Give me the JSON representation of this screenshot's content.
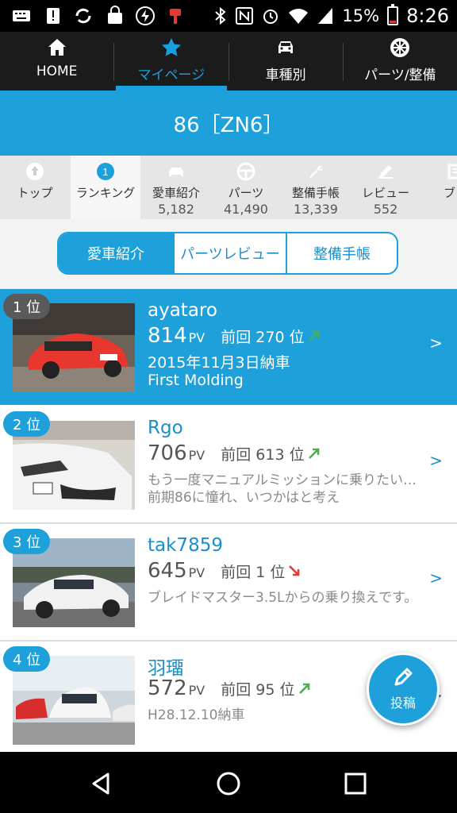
{
  "status_bar": {
    "battery": "15%",
    "time": "8:26",
    "battery_level": 0.15,
    "icons": [
      "keyboard-icon",
      "alert-icon",
      "sync-icon",
      "shopping-bag-icon",
      "charging-icon",
      "brush-icon",
      "bluetooth-icon",
      "nfc-icon",
      "alarm-icon",
      "wifi-icon",
      "signal-icon",
      "battery-icon"
    ]
  },
  "top_nav": {
    "items": [
      {
        "label": "HOME",
        "icon": "home-icon"
      },
      {
        "label": "マイページ",
        "icon": "star-icon"
      },
      {
        "label": "車種別",
        "icon": "car-icon"
      },
      {
        "label": "パーツ/整備",
        "icon": "wheel-icon"
      }
    ],
    "active_index": 1
  },
  "model": {
    "title": "86［ZN6］"
  },
  "sub_tabs": [
    {
      "label": "トップ",
      "count": "",
      "icon": "top-icon"
    },
    {
      "label": "ランキング",
      "count": "",
      "icon": "ranking-medal-icon"
    },
    {
      "label": "愛車紹介",
      "count": "5,182",
      "icon": "car-icon"
    },
    {
      "label": "パーツ",
      "count": "41,490",
      "icon": "steering-wheel-icon"
    },
    {
      "label": "整備手帳",
      "count": "13,339",
      "icon": "wrench-icon"
    },
    {
      "label": "レビュー",
      "count": "552",
      "icon": "review-icon"
    },
    {
      "label": "ブロ",
      "count": "",
      "icon": "blog-icon"
    }
  ],
  "segments": [
    {
      "label": "愛車紹介"
    },
    {
      "label": "パーツレビュー"
    },
    {
      "label": "整備手帳"
    }
  ],
  "ranking": [
    {
      "rank": "1 位",
      "name": "ayataro",
      "pv": "814",
      "pv_unit": "PV",
      "prev": "前回 270 位",
      "trend": "up",
      "desc": "2015年11月3日納車\nFirst Molding"
    },
    {
      "rank": "2 位",
      "name": "Rgo",
      "pv": "706",
      "pv_unit": "PV",
      "prev": "前回 613 位",
      "trend": "up",
      "desc": "もう一度マニュアルミッションに乗りたい…前期86に憧れ、いつかはと考え"
    },
    {
      "rank": "3 位",
      "name": "tak7859",
      "pv": "645",
      "pv_unit": "PV",
      "prev": "前回 1 位",
      "trend": "down",
      "desc": "ブレイドマスター3.5Lからの乗り換えです。"
    },
    {
      "rank": "4 位",
      "name": "羽璢",
      "pv": "572",
      "pv_unit": "PV",
      "prev": "前回 95 位",
      "trend": "up",
      "desc": "H28.12.10納車"
    }
  ],
  "chevron": ">",
  "fab": {
    "label": "投稿",
    "icon": "pen-icon"
  },
  "colors": {
    "accent": "#1ea0da",
    "trend_up": "#4caf50",
    "trend_down": "#e53935"
  }
}
